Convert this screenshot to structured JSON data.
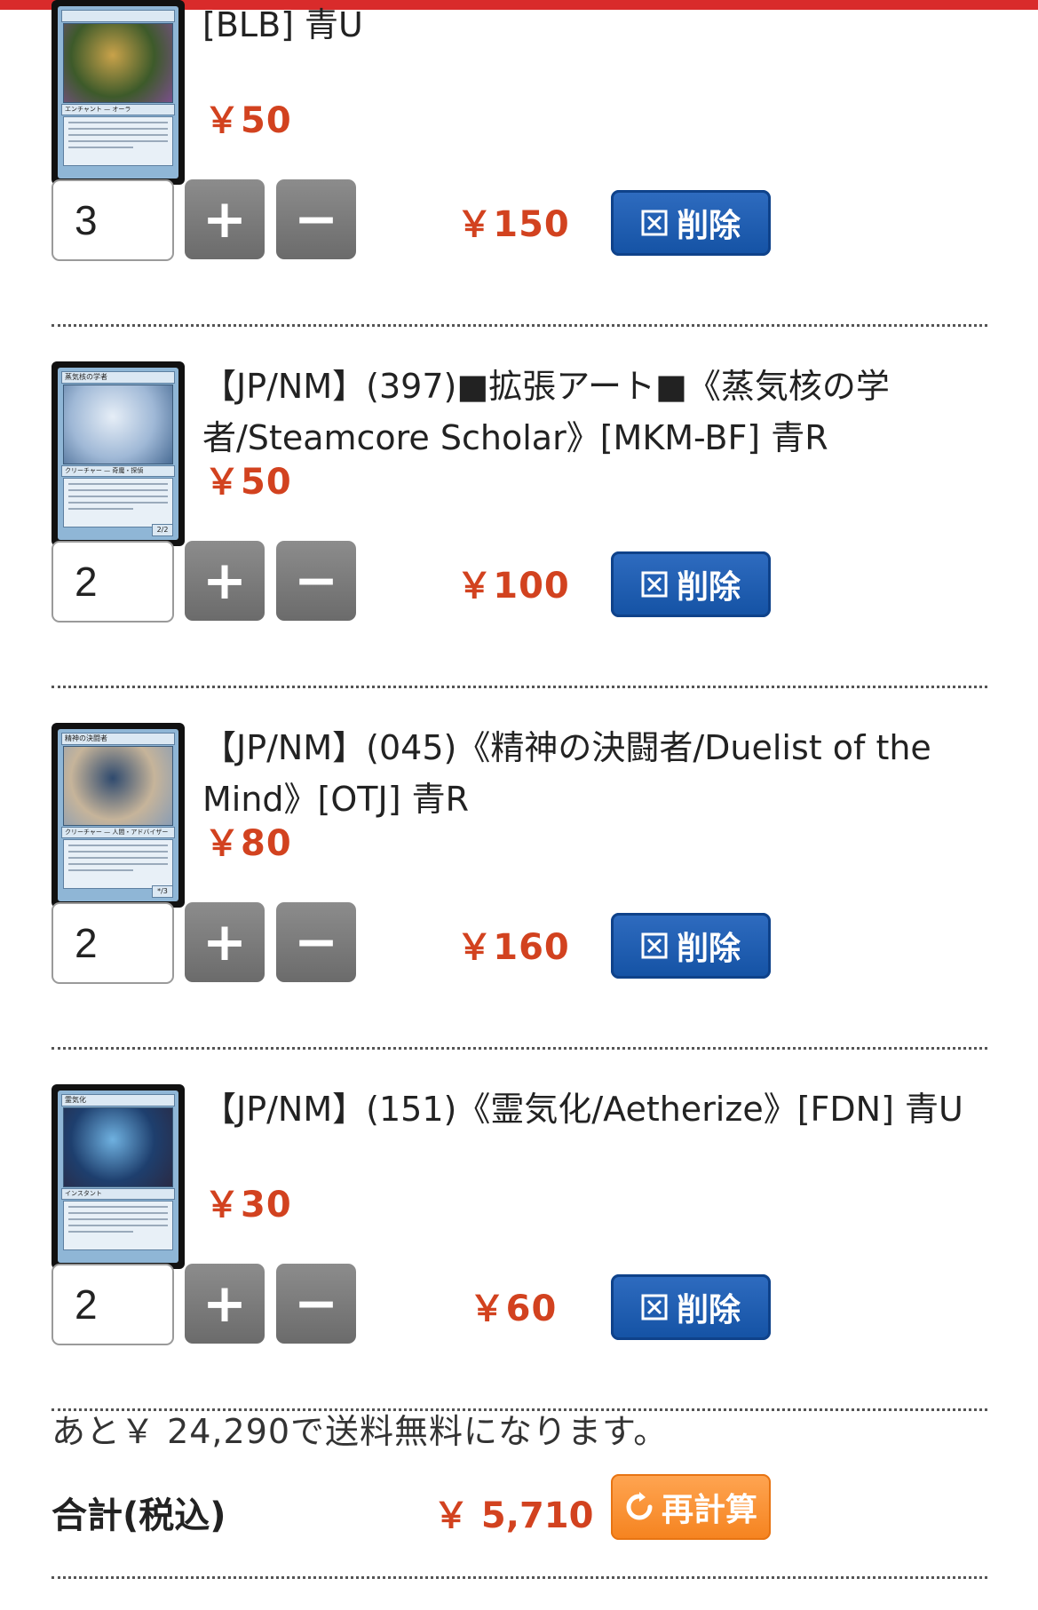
{
  "colors": {
    "top_bar": "#d92b2b",
    "price_red": "#d2421f",
    "delete_blue": "#1f5db2",
    "recalc_orange": "#f7902f",
    "step_button_gray": "#7a7a7a"
  },
  "icons": {
    "plus": "+",
    "minus": "−",
    "delete_icon": "box-x-icon",
    "recalc_icon": "refresh-icon"
  },
  "items": [
    {
      "name": "[BLB] 青U",
      "unit_price": "￥50",
      "quantity": "3",
      "line_total": "￥150",
      "delete_label": "削除",
      "card": {
        "title": "",
        "type": "エンチャント — オーラ",
        "pt": "",
        "art_colors": [
          "#3d5a2a",
          "#c9a24a",
          "#7a4f8a"
        ]
      }
    },
    {
      "name": "【JP/NM】(397)■拡張アート■《蒸気核の学者/Steamcore Scholar》[MKM-BF] 青R",
      "unit_price": "￥50",
      "quantity": "2",
      "line_total": "￥100",
      "delete_label": "削除",
      "card": {
        "title": "蒸気核の学者",
        "type": "クリーチャー — 奇魔・探偵",
        "pt": "2/2",
        "art_colors": [
          "#9fb8d6",
          "#e6eef7",
          "#4a6d96"
        ]
      }
    },
    {
      "name": "【JP/NM】(045)《精神の決闘者/Duelist of the Mind》[OTJ] 青R",
      "unit_price": "￥80",
      "quantity": "2",
      "line_total": "￥160",
      "delete_label": "削除",
      "card": {
        "title": "精神の決闘者",
        "type": "クリーチャー — 人間・アドバイザー",
        "pt": "*/3",
        "art_colors": [
          "#c6b49a",
          "#2f4a6e",
          "#8a9db4"
        ]
      }
    },
    {
      "name": "【JP/NM】(151)《霊気化/Aetherize》[FDN] 青U",
      "unit_price": "￥30",
      "quantity": "2",
      "line_total": "￥60",
      "delete_label": "削除",
      "card": {
        "title": "霊気化",
        "type": "インスタント",
        "pt": "",
        "art_colors": [
          "#1e3f6e",
          "#6fb1e0",
          "#2a2a44"
        ]
      }
    }
  ],
  "summary": {
    "shipping_note": "あと￥ 24,290で送料無料になります。",
    "total_label": "合計(税込)",
    "total_value": "￥ 5,710",
    "recalc_label": "再計算"
  }
}
